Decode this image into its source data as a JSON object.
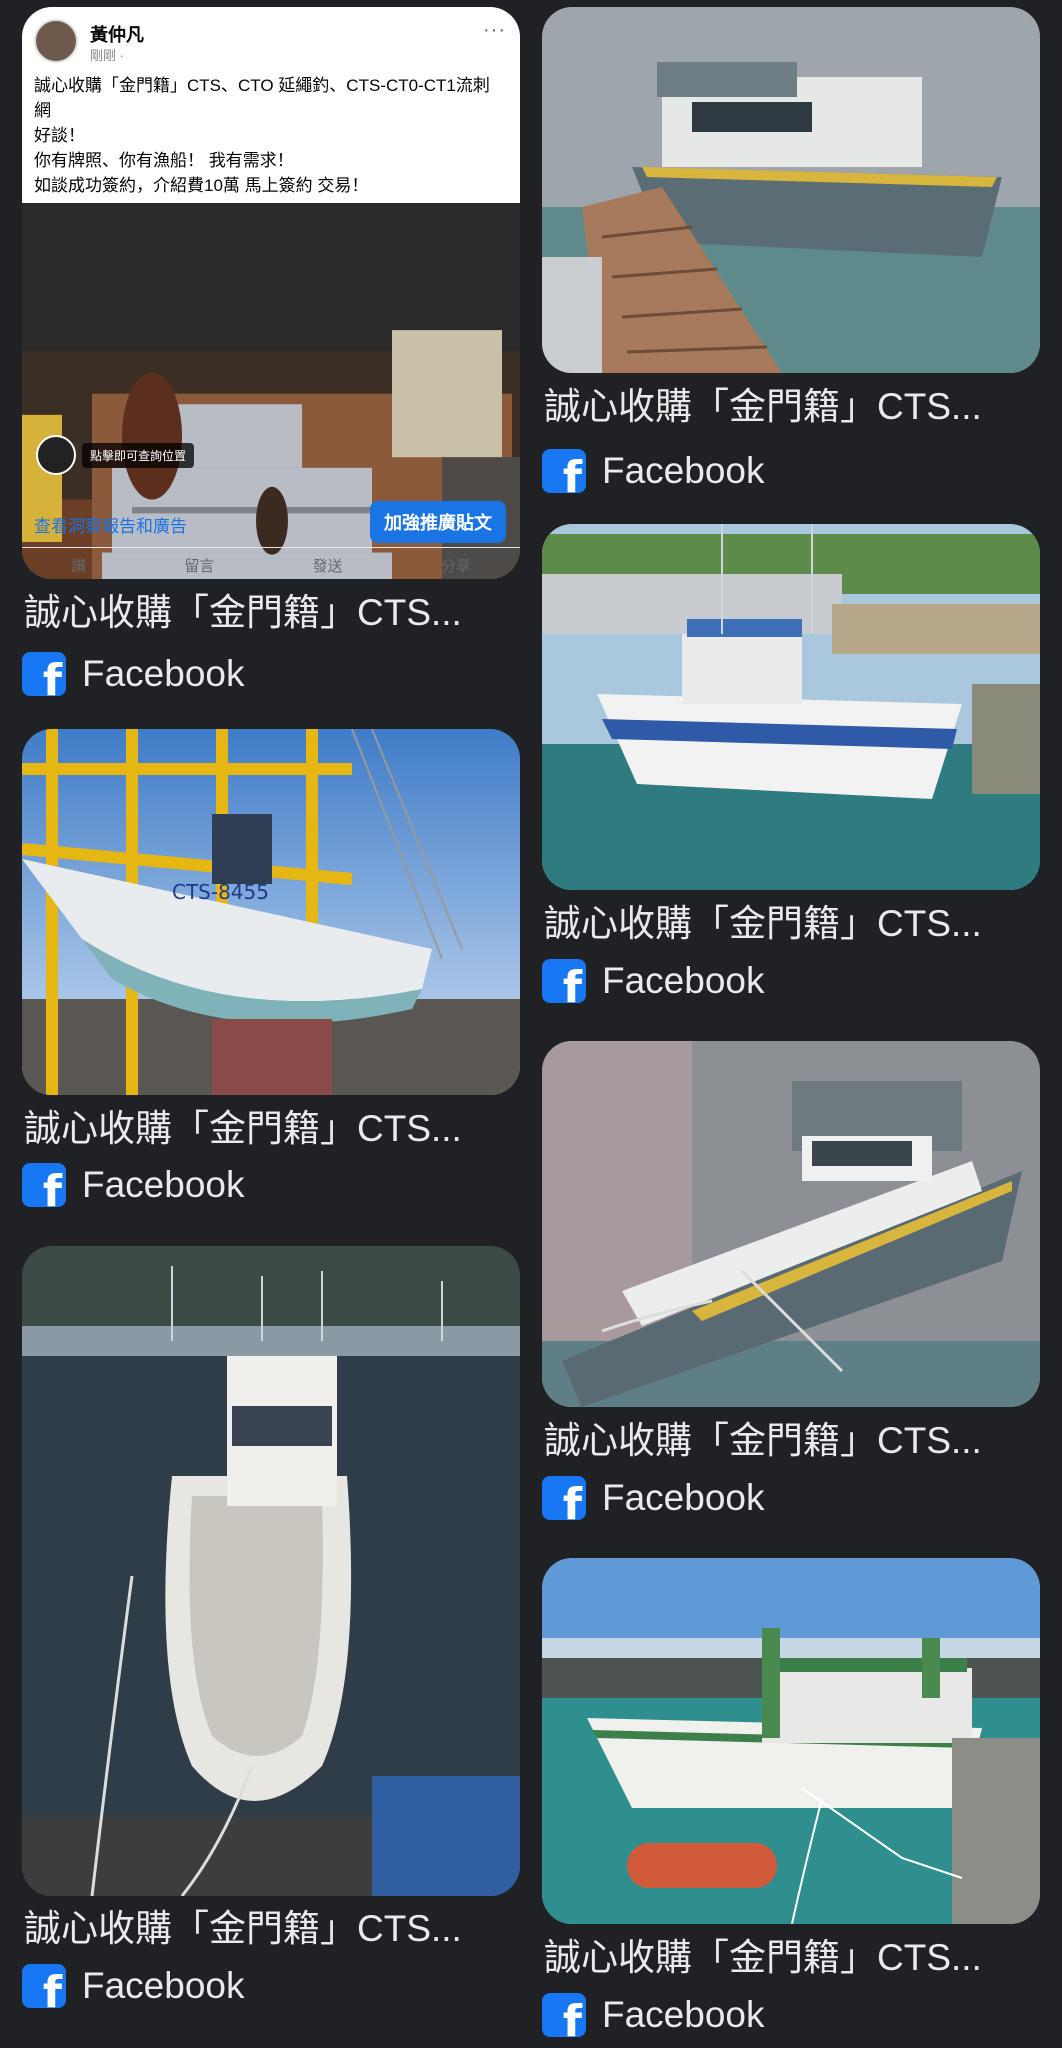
{
  "results": {
    "left": [
      {
        "title": "誠心收購「金門籍」CTS...",
        "source": "Facebook",
        "image": "facebook-post-screenshot"
      },
      {
        "title": "誠心收購「金門籍」CTS...",
        "source": "Facebook",
        "image": "boat-in-dry-dock"
      },
      {
        "title": "誠心收購「金門籍」CTS...",
        "source": "Facebook",
        "image": "white-boat-at-pier"
      }
    ],
    "right": [
      {
        "title": "誠心收購「金門籍」CTS...",
        "source": "Facebook",
        "image": "grey-boat-at-dock"
      },
      {
        "title": "誠心收購「金門籍」CTS...",
        "source": "Facebook",
        "image": "blue-white-fishing-boat"
      },
      {
        "title": "誠心收購「金門籍」CTS...",
        "source": "Facebook",
        "image": "grey-boat-blurred"
      },
      {
        "title": "誠心收購「金門籍」CTS...",
        "source": "Facebook",
        "image": "green-fishing-boat"
      }
    ]
  },
  "post": {
    "author": "黃仲凡",
    "time": "剛剛 · ",
    "more": "···",
    "text": "誠心收購「金門籍」CTS、CTO 延繩釣、CTS-CT0-CT1流刺網\n好談！\n你有牌照、你有漁船！ 我有需求！\n如談成功簽約，介紹費10萬 馬上簽約 交易！",
    "location_label": "點擊即可查詢位置",
    "insights": "查看洞察報告和廣告",
    "boost": "加強推廣貼文",
    "actions": [
      "讚",
      "留言",
      "發送",
      "分享"
    ]
  },
  "hull_text": "CTS-8455",
  "fb_glyph": "f",
  "colors": {
    "background": "#202124",
    "text": "#e8eaed",
    "facebook": "#1877f2"
  }
}
